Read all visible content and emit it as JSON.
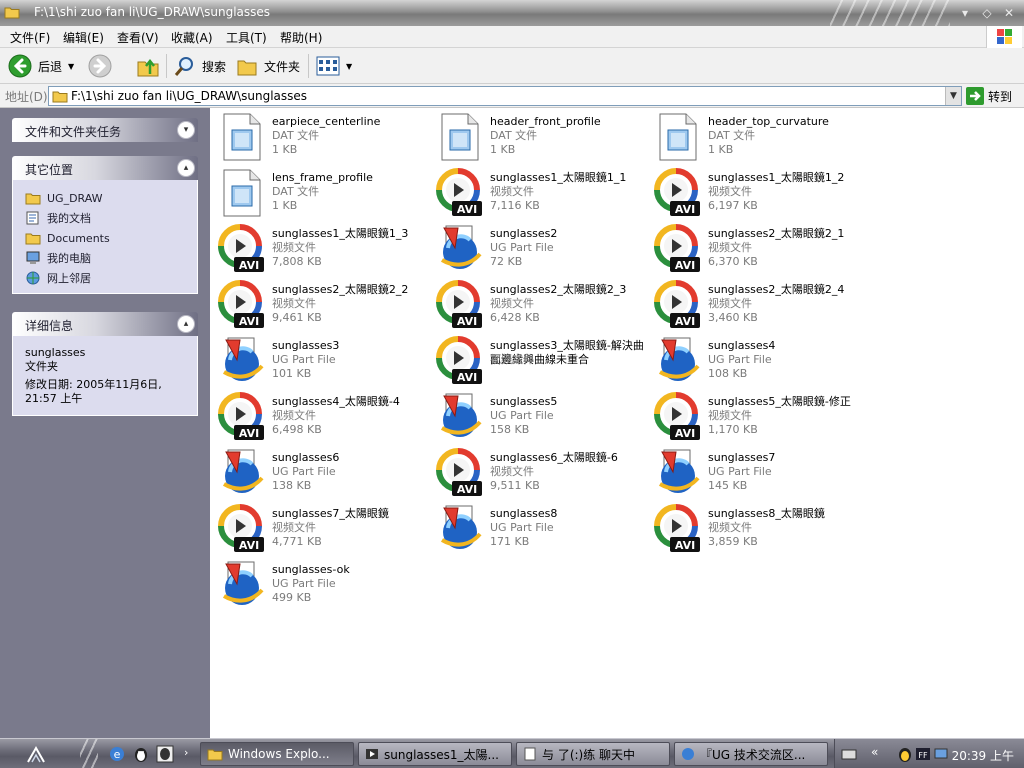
{
  "window": {
    "title": "F:\\1\\shi zuo fan li\\UG_DRAW\\sunglasses"
  },
  "menubar": {
    "items": [
      "文件(F)",
      "编辑(E)",
      "查看(V)",
      "收藏(A)",
      "工具(T)",
      "帮助(H)"
    ]
  },
  "toolbar": {
    "back_label": "后退",
    "search_label": "搜索",
    "folders_label": "文件夹"
  },
  "address": {
    "label": "地址(D)",
    "path": "F:\\1\\shi zuo fan li\\UG_DRAW\\sunglasses",
    "go_label": "转到"
  },
  "taskpane": {
    "file_tasks": {
      "title": "文件和文件夹任务"
    },
    "other_places": {
      "title": "其它位置",
      "items": [
        "UG_DRAW",
        "我的文档",
        "Documents",
        "我的电脑",
        "网上邻居"
      ]
    },
    "details": {
      "title": "详细信息",
      "name": "sunglasses",
      "kind": "文件夹",
      "modified": "修改日期: 2005年11月6日, 21:57 上午"
    }
  },
  "files": [
    {
      "name": "earpiece_centerline",
      "type": "DAT 文件",
      "size": "1 KB",
      "icon": "dat-file-icon"
    },
    {
      "name": "header_front_profile",
      "type": "DAT 文件",
      "size": "1 KB",
      "icon": "dat-file-icon"
    },
    {
      "name": "header_top_curvature",
      "type": "DAT 文件",
      "size": "1 KB",
      "icon": "dat-file-icon"
    },
    {
      "name": "lens_frame_profile",
      "type": "DAT 文件",
      "size": "1 KB",
      "icon": "dat-file-icon"
    },
    {
      "name": "sunglasses1_太陽眼鏡1_1",
      "type": "视频文件",
      "size": "7,116 KB",
      "icon": "avi-file-icon"
    },
    {
      "name": "sunglasses1_太陽眼鏡1_2",
      "type": "视频文件",
      "size": "6,197 KB",
      "icon": "avi-file-icon"
    },
    {
      "name": "sunglasses1_太陽眼鏡1_3",
      "type": "视频文件",
      "size": "7,808 KB",
      "icon": "avi-file-icon"
    },
    {
      "name": "sunglasses2",
      "type": "UG Part File",
      "size": "72 KB",
      "icon": "ug-part-file-icon"
    },
    {
      "name": "sunglasses2_太陽眼鏡2_1",
      "type": "视频文件",
      "size": "6,370 KB",
      "icon": "avi-file-icon"
    },
    {
      "name": "sunglasses2_太陽眼鏡2_2",
      "type": "视频文件",
      "size": "9,461 KB",
      "icon": "avi-file-icon"
    },
    {
      "name": "sunglasses2_太陽眼鏡2_3",
      "type": "视频文件",
      "size": "6,428 KB",
      "icon": "avi-file-icon"
    },
    {
      "name": "sunglasses2_太陽眼鏡2_4",
      "type": "视频文件",
      "size": "3,460 KB",
      "icon": "avi-file-icon"
    },
    {
      "name": "sunglasses3",
      "type": "UG Part File",
      "size": "101 KB",
      "icon": "ug-part-file-icon"
    },
    {
      "name": "sunglasses3_太陽眼鏡-解決曲面邊緣與曲線未重合",
      "type": "视频文件",
      "size": "",
      "icon": "avi-file-icon"
    },
    {
      "name": "sunglasses4",
      "type": "UG Part File",
      "size": "108 KB",
      "icon": "ug-part-file-icon"
    },
    {
      "name": "sunglasses4_太陽眼鏡-4",
      "type": "视频文件",
      "size": "6,498 KB",
      "icon": "avi-file-icon"
    },
    {
      "name": "sunglasses5",
      "type": "UG Part File",
      "size": "158 KB",
      "icon": "ug-part-file-icon"
    },
    {
      "name": "sunglasses5_太陽眼鏡-修正",
      "type": "视频文件",
      "size": "1,170 KB",
      "icon": "avi-file-icon"
    },
    {
      "name": "sunglasses6",
      "type": "UG Part File",
      "size": "138 KB",
      "icon": "ug-part-file-icon"
    },
    {
      "name": "sunglasses6_太陽眼鏡-6",
      "type": "视频文件",
      "size": "9,511 KB",
      "icon": "avi-file-icon"
    },
    {
      "name": "sunglasses7",
      "type": "UG Part File",
      "size": "145 KB",
      "icon": "ug-part-file-icon"
    },
    {
      "name": "sunglasses7_太陽眼鏡",
      "type": "视频文件",
      "size": "4,771 KB",
      "icon": "avi-file-icon"
    },
    {
      "name": "sunglasses8",
      "type": "UG Part File",
      "size": "171 KB",
      "icon": "ug-part-file-icon"
    },
    {
      "name": "sunglasses8_太陽眼鏡",
      "type": "视频文件",
      "size": "3,859 KB",
      "icon": "avi-file-icon"
    },
    {
      "name": "sunglasses-ok",
      "type": "UG Part File",
      "size": "499 KB",
      "icon": "ug-part-file-icon"
    }
  ],
  "taskbar": {
    "tasks": [
      {
        "label": "Windows Explo...",
        "active": true
      },
      {
        "label": "sunglasses1_太陽...",
        "active": false
      },
      {
        "label": "与 了(:)练 聊天中",
        "active": false
      },
      {
        "label": "『UG 技术交流区...",
        "active": false
      }
    ],
    "clock": "20:39 上午"
  },
  "colors": {
    "taskpane_bg": "#7a7a8c",
    "title_gradient": "#8f8f8f",
    "file_type_text": "#7b7b7b",
    "go_green": "#2e9b2e"
  }
}
